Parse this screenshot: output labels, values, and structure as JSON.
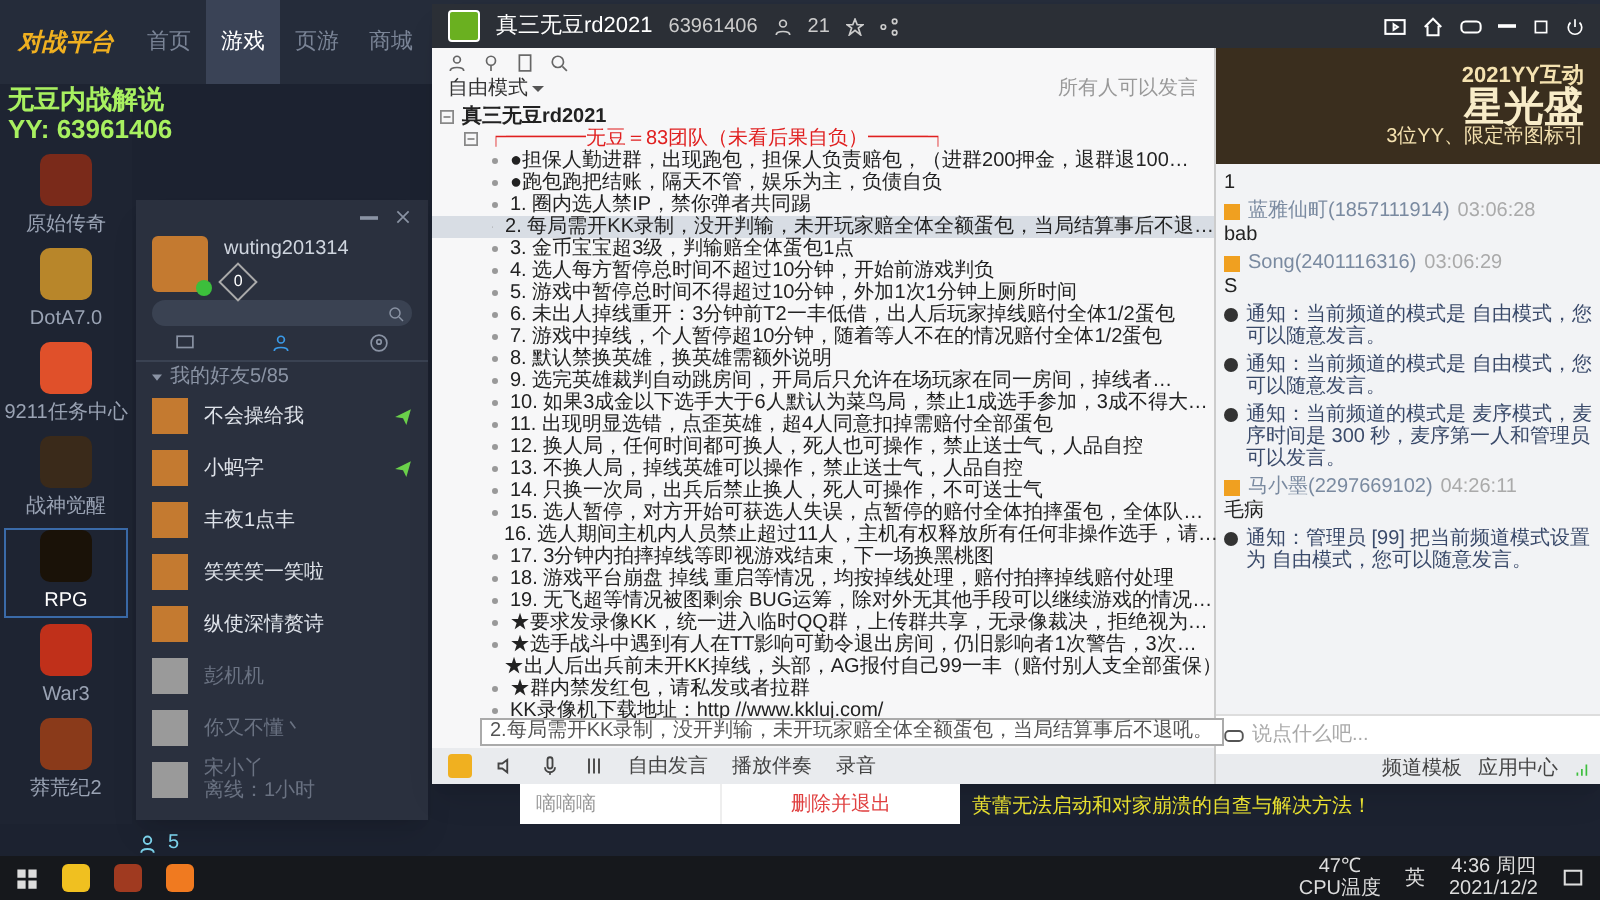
{
  "platform": {
    "logo": "对战平台",
    "nav": [
      {
        "label": "首页",
        "selected": false
      },
      {
        "label": "游戏",
        "selected": true
      },
      {
        "label": "页游",
        "selected": false
      },
      {
        "label": "商城",
        "selected": false
      }
    ],
    "games": [
      {
        "label": "原始传奇",
        "selected": false
      },
      {
        "label": "DotA7.0",
        "selected": false
      },
      {
        "label": "9211任务中心",
        "selected": false
      },
      {
        "label": "战神觉醒",
        "selected": false
      },
      {
        "label": "RPG",
        "selected": true
      },
      {
        "label": "War3",
        "selected": false
      },
      {
        "label": "莽荒纪2",
        "selected": false
      }
    ],
    "strip_count": "5"
  },
  "overlay": {
    "title": "无豆内战解说",
    "id": "YY: 63961406"
  },
  "friends": {
    "user": "wuting201314",
    "badge": "0",
    "online": true,
    "group": {
      "label": "我的好友5/85",
      "expanded": true
    },
    "items": [
      {
        "name": "不会操给我",
        "online": true,
        "messaging": true
      },
      {
        "name": "小蚂字",
        "online": true,
        "messaging": true
      },
      {
        "name": "丰夜1点丰",
        "online": true,
        "messaging": false
      },
      {
        "name": "笑笑笑一笑啦",
        "online": true,
        "messaging": false
      },
      {
        "name": "纵使深情赘诗",
        "online": true,
        "messaging": false
      },
      {
        "name": "彭机机",
        "online": false,
        "messaging": false
      },
      {
        "name": "你又不懂丶",
        "online": false,
        "messaging": false
      },
      {
        "name": "宋小丫",
        "online": false,
        "messaging": false,
        "status": "离线：1小时"
      }
    ]
  },
  "yy": {
    "title": "真三无豆rd2021",
    "id": "63961406",
    "members": "21",
    "mode": "自由模式",
    "mode_note": "所有人可以发言",
    "tree": [
      {
        "label": "真三无豆rd2021",
        "expanded": true,
        "children": [
          {
            "label": "┍━━━━无豆＝83团队（未看后果自负）━━━┑",
            "expanded": true,
            "children": [
              {
                "label": "●担保人勤进群，出现跑包，担保人负责赔包，（进群200押金，退群退100…",
                "selected": false
              },
              {
                "label": "●跑包跑把结账，隔天不管，娱乐为主，负债自负",
                "selected": false
              },
              {
                "label": "1. 圈内选人禁IP，禁你弹者共同踢",
                "selected": false
              },
              {
                "label": "2. 每局需开KK录制，没开判输，未开玩家赔全体全额蛋包，当局结算事后不退…",
                "selected": true
              },
              {
                "label": "3. 金币宝宝超3级，判输赔全体蛋包1点",
                "selected": false
              },
              {
                "label": "4. 选人每方暂停总时间不超过10分钟，开始前游戏判负",
                "selected": false
              },
              {
                "label": "5. 游戏中暂停总时间不得超过10分钟，外加1次1分钟上厕所时间",
                "selected": false
              },
              {
                "label": "6. 未出人掉线重开：3分钟前T2一丰低借，出人后玩家掉线赔付全体1/2蛋包",
                "selected": false
              },
              {
                "label": "7. 游戏中掉线，个人暂停超10分钟，随着等人不在的情况赔付全体1/2蛋包",
                "selected": false
              },
              {
                "label": "8. 默认禁换英雄，换英雄需额外说明",
                "selected": false
              },
              {
                "label": "9. 选完英雄裁判自动跳房间，开局后只允许在场玩家在同一房间，掉线者…",
                "selected": false
              },
              {
                "label": "10. 如果3成金以下选手大于6人默认为菜鸟局，禁止1成选手参加，3成不得大…",
                "selected": false
              },
              {
                "label": "11. 出现明显选错，点歪英雄，超4人同意扣掉需赔付全部蛋包",
                "selected": false
              },
              {
                "label": "12. 换人局，任何时间都可换人，死人也可操作，禁止送士气，人品自控",
                "selected": false
              },
              {
                "label": "13. 不换人局，掉线英雄可以操作，禁止送士气，人品自控",
                "selected": false
              },
              {
                "label": "14. 只换一次局，出兵后禁止换人，死人可操作，不可送士气",
                "selected": false
              },
              {
                "label": "15. 选人暂停，对方开始可获选人失误，点暂停的赔付全体拍摔蛋包，全体队…",
                "selected": false
              },
              {
                "label": "16. 选人期间主机内人员禁止超过11人，主机有权释放所有任何非操作选手，请…",
                "selected": false
              },
              {
                "label": "17. 3分钟内拍摔掉线等即视游戏结束，下一场换黑桃图",
                "selected": false
              },
              {
                "label": "18. 游戏平台崩盘 掉线 重启等情况，均按掉线处理，赔付拍摔掉线赔付处理",
                "selected": false
              },
              {
                "label": "19. 无飞超等情况被图剩余 BUG运筹，除对外无其他手段可以继续游戏的情况…",
                "selected": false
              },
              {
                "label": "★要求发录像KK，统一进入临时QQ群，上传群共享，无录像裁决，拒绝视为…",
                "selected": false
              },
              {
                "label": "★选手战斗中遇到有人在TT影响可勤令退出房间，仍旧影响者1次警告，3次…",
                "selected": false
              },
              {
                "label": "★出人后出兵前未开KK掉线，头部，AG报付自己99一丰（赔付别人支全部蛋保）",
                "selected": false
              },
              {
                "label": "★群内禁发红包，请私发或者拉群",
                "selected": false
              },
              {
                "label": "KK录像机下载地址：http //www.kkluj.com/",
                "selected": false
              }
            ]
          }
        ]
      }
    ],
    "tooltip": "2.每局需开KK录制，没开判输，未开玩家赔全体全额蛋包，当局结算事后不退吼。",
    "toolbar": [
      "自由发言",
      "播放伴奏",
      "录音"
    ],
    "banner": {
      "line1": "2021YY互动",
      "line2": "星光盛",
      "line3": "3位YY、限定帝图标引"
    },
    "chat": [
      {
        "kind": "text",
        "text": "1"
      },
      {
        "kind": "message",
        "user": "蓝雅仙町(1857111914)",
        "time": "03:06:28",
        "text": "bab"
      },
      {
        "kind": "message",
        "user": "Song(2401116316)",
        "time": "03:06:29",
        "text": "S"
      },
      {
        "kind": "notice",
        "text": "通知：当前频道的模式是 自由模式，您可以随意发言。"
      },
      {
        "kind": "notice",
        "text": "通知：当前频道的模式是 自由模式，您可以随意发言。"
      },
      {
        "kind": "notice",
        "text": "通知：当前频道的模式是 麦序模式，麦序时间是 300 秒，麦序第一人和管理员可以发言。"
      },
      {
        "kind": "message",
        "user": "马小墨(2297669102)",
        "time": "04:26:11",
        "text": "毛病"
      },
      {
        "kind": "notice",
        "text": "通知：管理员 [99] 把当前频道模式设置为 自由模式，您可以随意发言。"
      }
    ],
    "input": {
      "placeholder": "说点什么吧..."
    },
    "footer": [
      "频道模板",
      "应用中心"
    ]
  },
  "dialog": {
    "item": "嘀嘀嘀",
    "button": "删除并退出"
  },
  "ticker": "黄蕾无法启动和对家崩溃的自查与解决方法！",
  "taskbar": {
    "temp": "47℃",
    "temp_label": "CPU温度",
    "ime": "英",
    "time": "4:36 周四",
    "date": "2021/12/2"
  }
}
